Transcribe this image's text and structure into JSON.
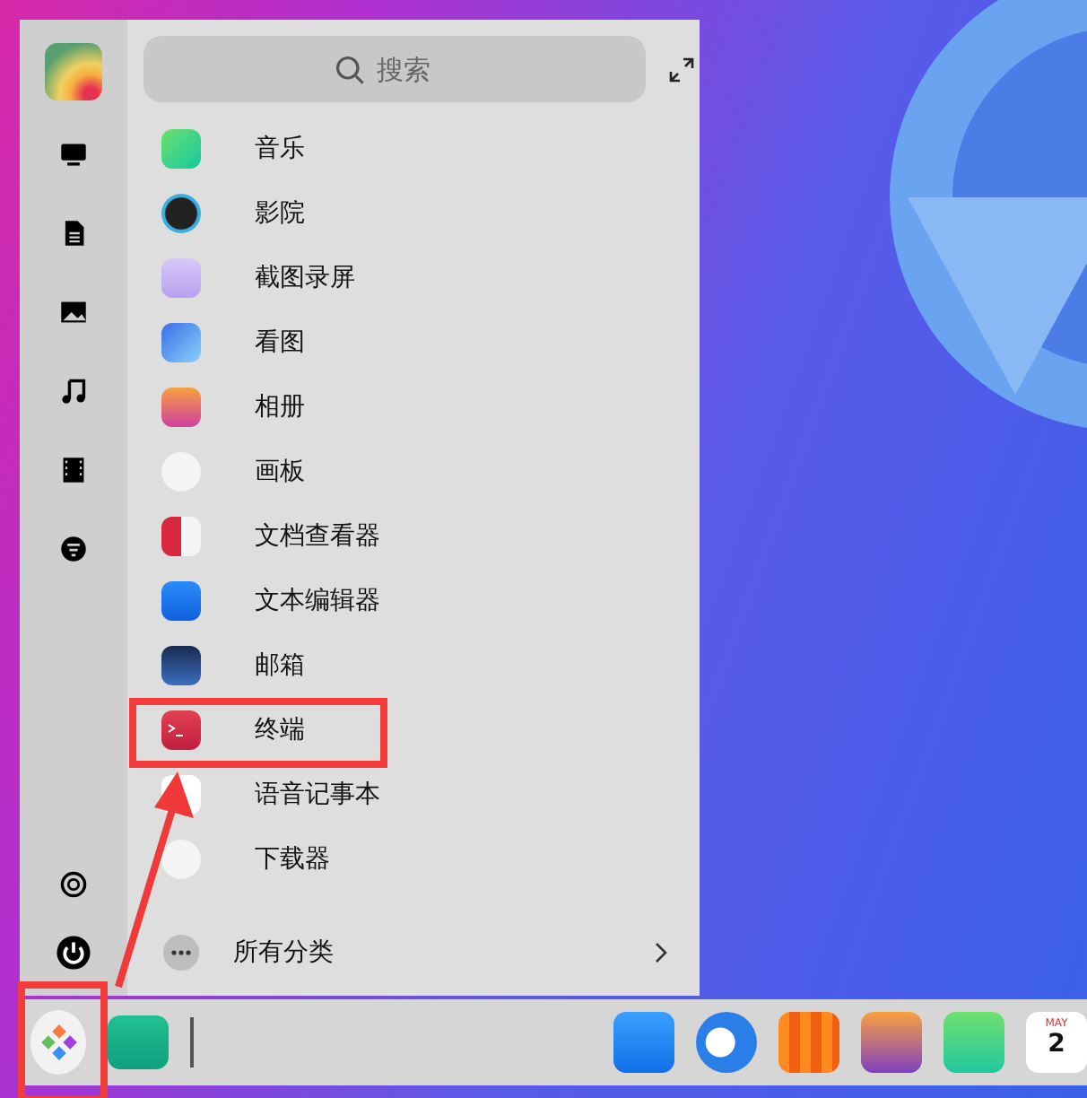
{
  "sidebar": {
    "top": [
      {
        "kind": "avatar"
      },
      {
        "kind": "computer"
      },
      {
        "kind": "document"
      },
      {
        "kind": "picture"
      },
      {
        "kind": "music"
      },
      {
        "kind": "video"
      },
      {
        "kind": "download"
      }
    ],
    "bottom": [
      {
        "kind": "settings"
      },
      {
        "kind": "power"
      }
    ]
  },
  "search": {
    "placeholder": "搜索"
  },
  "apps": [
    {
      "name": "音乐",
      "kind": "music",
      "highlighted": false
    },
    {
      "name": "影院",
      "kind": "movie",
      "highlighted": false
    },
    {
      "name": "截图录屏",
      "kind": "camera",
      "highlighted": false
    },
    {
      "name": "看图",
      "kind": "viewer",
      "highlighted": false
    },
    {
      "name": "相册",
      "kind": "album",
      "highlighted": false
    },
    {
      "name": "画板",
      "kind": "draw",
      "highlighted": false
    },
    {
      "name": "文档查看器",
      "kind": "reader",
      "highlighted": false
    },
    {
      "name": "文本编辑器",
      "kind": "editor",
      "highlighted": false
    },
    {
      "name": "邮箱",
      "kind": "mail",
      "highlighted": false
    },
    {
      "name": "终端",
      "kind": "terminal",
      "highlighted": true
    },
    {
      "name": "语音记事本",
      "kind": "voice",
      "highlighted": false
    },
    {
      "name": "下载器",
      "kind": "downloader",
      "highlighted": false
    }
  ],
  "all_categories": {
    "label": "所有分类"
  },
  "dock": {
    "launcher": {
      "highlighted": true
    },
    "items": [
      {
        "kind": "files"
      },
      {
        "kind": "divider"
      },
      {
        "kind": "wallet"
      },
      {
        "kind": "browser"
      },
      {
        "kind": "store"
      },
      {
        "kind": "album"
      },
      {
        "kind": "music"
      },
      {
        "kind": "calendar",
        "month": "MAY",
        "day": "2"
      }
    ]
  }
}
